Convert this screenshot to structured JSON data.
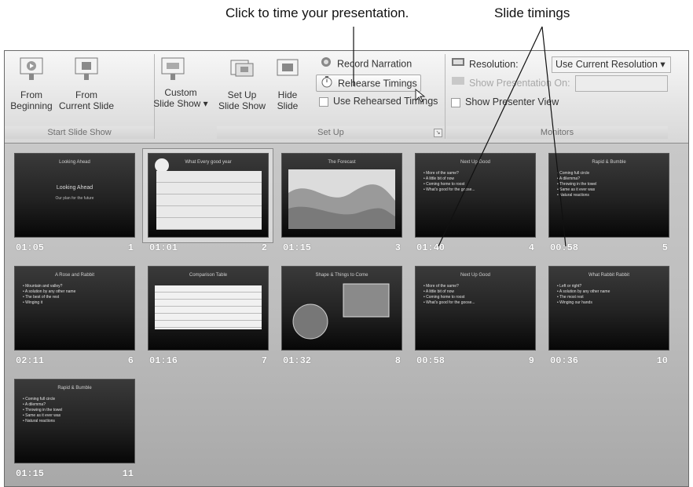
{
  "callouts": {
    "rehearse": "Click to time your presentation.",
    "timings": "Slide timings"
  },
  "ribbon": {
    "start_group": {
      "label": "Start Slide Show",
      "from_beginning": [
        "From",
        "Beginning"
      ],
      "from_current": [
        "From",
        "Current Slide"
      ],
      "custom": [
        "Custom",
        "Slide Show ▾"
      ]
    },
    "setup_group": {
      "label": "Set Up",
      "setup_show": [
        "Set Up",
        "Slide Show"
      ],
      "hide_slide": [
        "Hide",
        "Slide"
      ],
      "record_narration": "Record Narration",
      "rehearse_timings": "Rehearse Timings",
      "use_rehearsed": "Use Rehearsed Timings"
    },
    "monitors_group": {
      "label": "Monitors",
      "resolution_label": "Resolution:",
      "resolution_value": "Use Current Resolution",
      "show_presentation_on": "Show Presentation On:",
      "presenter_view": "Show Presenter View"
    }
  },
  "slides": [
    {
      "number": "1",
      "time": "01:05",
      "title": "Looking Ahead",
      "subtitle": "Our plan for the future",
      "layout": "title"
    },
    {
      "number": "2",
      "time": "01:01",
      "title": "What Every good year",
      "layout": "table"
    },
    {
      "number": "3",
      "time": "01:15",
      "title": "The Forecast",
      "layout": "chart"
    },
    {
      "number": "4",
      "time": "01:40",
      "title": "Next Up Good",
      "layout": "bullets",
      "bullets": [
        "More of the same?",
        "A little bit of now",
        "Coming home to roost",
        "What's good for the goose..."
      ]
    },
    {
      "number": "5",
      "time": "00:58",
      "title": "Rapid & Bumble",
      "layout": "bullets",
      "bullets": [
        "Coming full circle",
        "A dilemma?",
        "Throwing in the towel",
        "Same as it ever was",
        "Natural reactions"
      ]
    },
    {
      "number": "6",
      "time": "02:11",
      "title": "A Rose and Rabbit",
      "layout": "bullets",
      "bullets": [
        "Mountain and valley?",
        "A solution by any other name",
        "The best of the rest",
        "Winging it"
      ]
    },
    {
      "number": "7",
      "time": "01:16",
      "title": "Comparison Table",
      "layout": "lines"
    },
    {
      "number": "8",
      "time": "01:32",
      "title": "Shape & Things to Come",
      "layout": "shapes"
    },
    {
      "number": "9",
      "time": "00:58",
      "title": "Next Up Good",
      "layout": "bullets",
      "bullets": [
        "More of the same?",
        "A little bit of now",
        "Coming home to roost",
        "What's good for the goose..."
      ]
    },
    {
      "number": "10",
      "time": "00:36",
      "title": "What Rabbit Rabbit",
      "layout": "bullets",
      "bullets": [
        "Left or right?",
        "A solution by any other name",
        "The most rest",
        "Winging our hands"
      ]
    },
    {
      "number": "11",
      "time": "01:15",
      "title": "Rapid & Bumble",
      "layout": "bullets",
      "bullets": [
        "Coming full circle",
        "A dilemma?",
        "Throwing in the towel",
        "Same as it ever was",
        "Natural reactions"
      ]
    }
  ]
}
